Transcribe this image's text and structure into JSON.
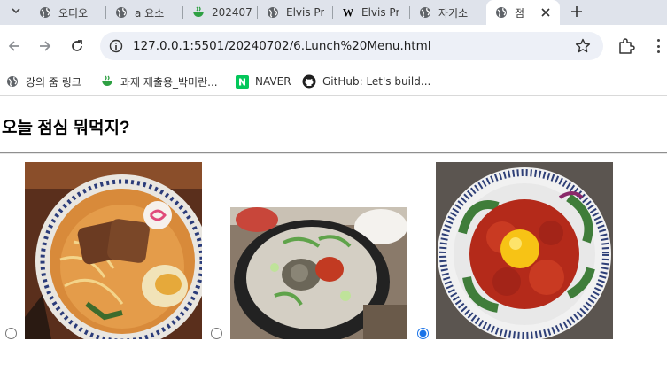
{
  "browser": {
    "tabs": [
      {
        "title": "오디오",
        "icon": "globe-icon"
      },
      {
        "title": "a 요소",
        "icon": "globe-icon"
      },
      {
        "title": "202407",
        "icon": "teacup-icon"
      },
      {
        "title": "Elvis Pr",
        "icon": "globe-icon"
      },
      {
        "title": "Elvis Pr",
        "icon": "wikipedia-icon"
      },
      {
        "title": "자기소",
        "icon": "globe-icon"
      },
      {
        "title": "점",
        "icon": "globe-icon",
        "active": true
      }
    ],
    "url": "127.0.0.1:5501/20240702/6.Lunch%20Menu.html",
    "bookmarks": [
      {
        "label": "강의 줌 링크",
        "icon": "globe-icon"
      },
      {
        "label": "과제 제출용_박미란...",
        "icon": "teacup-icon"
      },
      {
        "label": "NAVER",
        "icon": "naver-icon"
      },
      {
        "label": "GitHub: Let's build...",
        "icon": "github-icon"
      }
    ]
  },
  "page": {
    "title": "오늘 점심 뭐먹지?",
    "menu_options": [
      {
        "image": "ramen-image",
        "selected": false
      },
      {
        "image": "gukbap-image",
        "selected": false
      },
      {
        "image": "yukhoe-image",
        "selected": true
      }
    ]
  },
  "colors": {
    "tab_strip": "#dfe3eb",
    "omnibox": "#edf0f7",
    "radio_accent": "#1a73e8"
  }
}
